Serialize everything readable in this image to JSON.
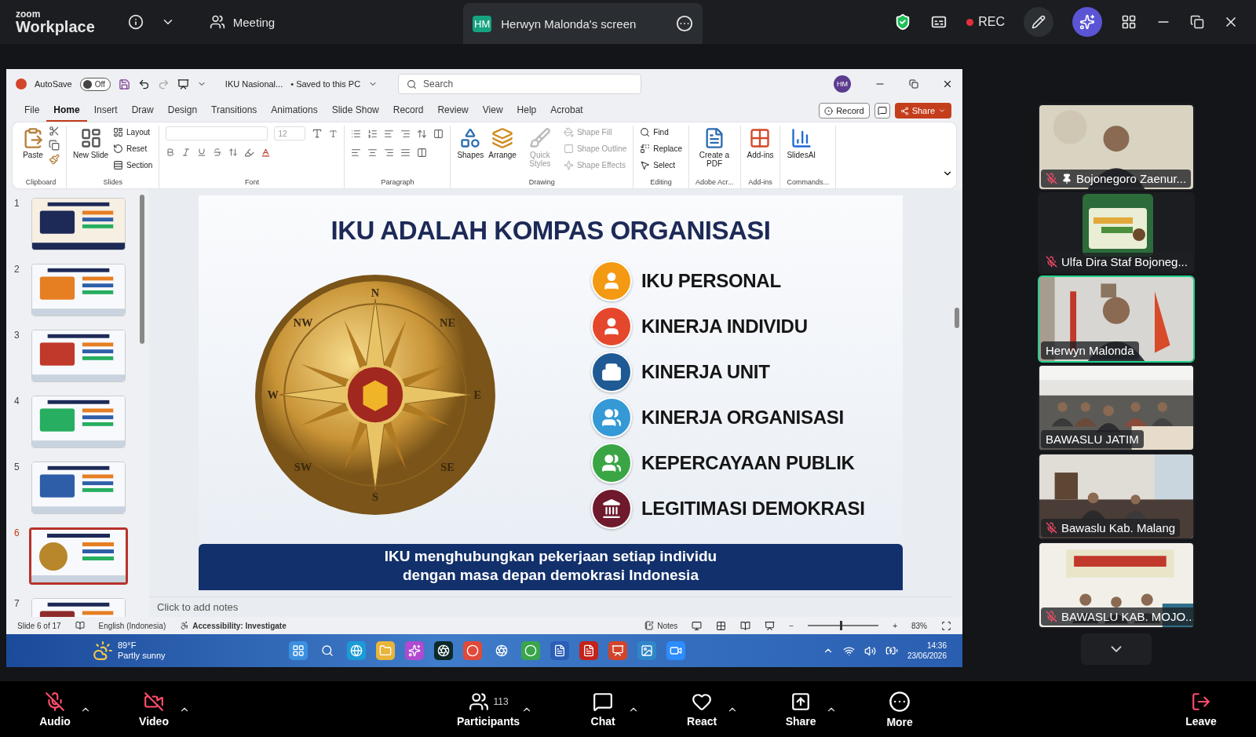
{
  "zoom_bar": {
    "brand_small": "zoom",
    "brand": "Workplace",
    "meeting": "Meeting",
    "share_tab": {
      "initials": "HM",
      "title": "Herwyn Malonda's screen"
    },
    "recording": "REC"
  },
  "powerpoint": {
    "autosave": {
      "label": "AutoSave",
      "on": false,
      "state": "Off"
    },
    "file_name": "IKU Nasional...",
    "save_status": "• Saved to this PC",
    "search": {
      "placeholder": "Search"
    },
    "account": "HM",
    "menu_tabs": [
      {
        "label": "File",
        "selected": false
      },
      {
        "label": "Home",
        "selected": true
      },
      {
        "label": "Insert",
        "selected": false
      },
      {
        "label": "Draw",
        "selected": false
      },
      {
        "label": "Design",
        "selected": false
      },
      {
        "label": "Transitions",
        "selected": false
      },
      {
        "label": "Animations",
        "selected": false
      },
      {
        "label": "Slide Show",
        "selected": false
      },
      {
        "label": "Record",
        "selected": false
      },
      {
        "label": "Review",
        "selected": false
      },
      {
        "label": "View",
        "selected": false
      },
      {
        "label": "Help",
        "selected": false
      },
      {
        "label": "Acrobat",
        "selected": false
      }
    ],
    "record_button": "Record",
    "share_button": "Share",
    "ribbon": [
      {
        "kind": "buttons",
        "label": "Clipboard",
        "buttons": [
          {
            "kind": "large",
            "label": "Paste",
            "disabled": false
          }
        ]
      },
      {
        "kind": "buttons",
        "label": "Slides",
        "buttons": [
          {
            "kind": "large",
            "label": "New Slide",
            "disabled": false
          },
          {
            "kind": "small",
            "label": "Layout",
            "disabled": false
          },
          {
            "kind": "small",
            "label": "Reset",
            "disabled": false
          },
          {
            "kind": "small",
            "label": "Section",
            "disabled": false
          }
        ]
      },
      {
        "kind": "font",
        "label": "Font",
        "font_size": "12"
      },
      {
        "kind": "paragraph",
        "label": "Paragraph"
      },
      {
        "kind": "buttons",
        "label": "Drawing",
        "buttons": [
          {
            "kind": "large",
            "label": "Shapes",
            "disabled": false
          },
          {
            "kind": "large",
            "label": "Arrange",
            "disabled": false
          },
          {
            "kind": "large",
            "label": "Quick Styles",
            "disabled": true
          },
          {
            "kind": "small",
            "label": "Shape Fill",
            "disabled": true
          },
          {
            "kind": "small",
            "label": "Shape Outline",
            "disabled": true
          },
          {
            "kind": "small",
            "label": "Shape Effects",
            "disabled": true
          }
        ]
      },
      {
        "kind": "buttons",
        "label": "Editing",
        "buttons": [
          {
            "kind": "small",
            "label": "Find",
            "disabled": false
          },
          {
            "kind": "small",
            "label": "Replace",
            "disabled": false
          },
          {
            "kind": "small",
            "label": "Select",
            "disabled": false
          }
        ]
      },
      {
        "kind": "buttons",
        "label": "Adobe Acr...",
        "buttons": [
          {
            "kind": "large",
            "label": "Create a PDF",
            "disabled": false
          }
        ]
      },
      {
        "kind": "buttons",
        "label": "Add-ins",
        "buttons": [
          {
            "kind": "large",
            "label": "Add-ins",
            "disabled": false
          }
        ]
      },
      {
        "kind": "buttons",
        "label": "Commands...",
        "buttons": [
          {
            "kind": "large",
            "label": "SlidesAI",
            "disabled": false
          }
        ]
      }
    ],
    "slides": [
      {
        "number": "1",
        "selected": false
      },
      {
        "number": "2",
        "selected": false
      },
      {
        "number": "3",
        "selected": false
      },
      {
        "number": "4",
        "selected": false
      },
      {
        "number": "5",
        "selected": false
      },
      {
        "number": "6",
        "selected": true
      },
      {
        "number": "7",
        "selected": false
      }
    ],
    "slide": {
      "title": "IKU ADALAH KOMPAS ORGANISASI",
      "compass_labels": [
        "N",
        "NE",
        "E",
        "SE",
        "S",
        "SW",
        "W",
        "NW"
      ],
      "items": [
        {
          "label": "IKU PERSONAL",
          "color": "#f39a12"
        },
        {
          "label": "KINERJA INDIVIDU",
          "color": "#e5472c"
        },
        {
          "label": "KINERJA UNIT",
          "color": "#1f5a94"
        },
        {
          "label": "KINERJA ORGANISASI",
          "color": "#3599d6"
        },
        {
          "label": "KEPERCAYAAN PUBLIK",
          "color": "#3aa545"
        },
        {
          "label": "LEGITIMASI DEMOKRASI",
          "color": "#6e1a2c"
        }
      ],
      "footer": [
        "IKU menghubungkan pekerjaan setiap individu",
        "dengan masa depan demokrasi Indonesia"
      ]
    },
    "notes_placeholder": "Click to add notes",
    "status_bar": {
      "slide": "Slide 6 of 17",
      "language": "English (Indonesia)",
      "accessibility": "Accessibility: Investigate",
      "notes": "Notes",
      "zoom_out": "−",
      "zoom_in": "+",
      "zoom": {
        "level": 0.45
      },
      "zoom_reading": "83%"
    }
  },
  "taskbar": {
    "temperature": "89°F",
    "weather": "Partly sunny",
    "time": "14:36",
    "date": "23/06/2026"
  },
  "participants": [
    {
      "name": "Bojonegoro Zaenur...",
      "muted": true,
      "pinned": true,
      "active": false,
      "kind": "camera"
    },
    {
      "name": "Ulfa Dira Staf Bojoneg...",
      "muted": true,
      "pinned": false,
      "active": false,
      "kind": "avatar"
    },
    {
      "name": "Herwyn Malonda",
      "muted": false,
      "pinned": false,
      "active": true,
      "kind": "camera"
    },
    {
      "name": "BAWASLU JATIM",
      "muted": false,
      "pinned": false,
      "active": false,
      "kind": "camera"
    },
    {
      "name": "Bawaslu Kab. Malang",
      "muted": true,
      "pinned": false,
      "active": false,
      "kind": "camera"
    },
    {
      "name": "BAWASLU KAB. MOJO...",
      "muted": true,
      "pinned": false,
      "active": false,
      "kind": "camera"
    }
  ],
  "toolbar": [
    {
      "kind": "audio",
      "label": "Audio",
      "off": true
    },
    {
      "kind": "video",
      "label": "Video",
      "off": true
    },
    {
      "kind": "participants",
      "label": "Participants",
      "count": "113"
    },
    {
      "kind": "chat",
      "label": "Chat"
    },
    {
      "kind": "react",
      "label": "React"
    },
    {
      "kind": "share",
      "label": "Share"
    },
    {
      "kind": "more",
      "label": "More"
    },
    {
      "kind": "leave",
      "label": "Leave"
    }
  ]
}
